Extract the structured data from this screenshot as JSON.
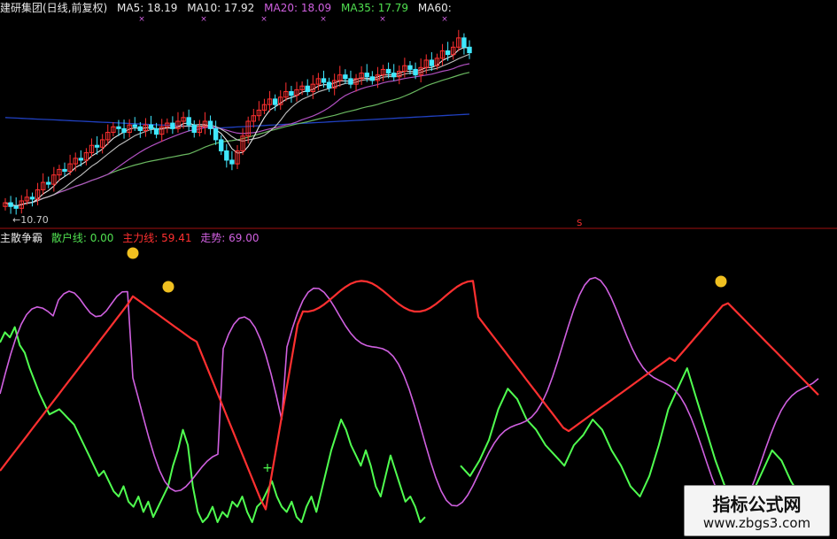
{
  "header": {
    "title": "建研集团(日线,前复权)",
    "ma": [
      {
        "label": "MA5: 18.19",
        "color": "#e8e8e8"
      },
      {
        "label": "MA10: 17.92",
        "color": "#e8e8e8"
      },
      {
        "label": "MA20: 18.09",
        "color": "#d060e0"
      },
      {
        "label": "MA35: 17.79",
        "color": "#50e050"
      },
      {
        "label": "MA60:",
        "color": "#e8e8e8"
      }
    ]
  },
  "lower_header": {
    "title": "主散争霸",
    "items": [
      {
        "label": "散户线: 0.00",
        "color": "#50e050"
      },
      {
        "label": "主力线: 59.41",
        "color": "#ff3030"
      },
      {
        "label": "走势: 69.00",
        "color": "#d060e0"
      }
    ]
  },
  "annotations": {
    "low_label": "←10.70",
    "s_mark": "S"
  },
  "watermark": {
    "line1": "指标公式网",
    "line2": "www.zbgs3.com"
  },
  "colors": {
    "up": "#ff3030",
    "down": "#40e8ff",
    "retail": "#50ff50",
    "main": "#ff3030",
    "trend": "#d060e0",
    "ma_white": "#e8e8e8",
    "ma_purple": "#b050c0",
    "ma_green": "#6ab860",
    "ma_blue": "#2040c0",
    "divider": "#a01010"
  },
  "chart_data": [
    {
      "type": "candlestick",
      "title": "建研集团(日线,前复权)",
      "x_index": [
        0,
        130
      ],
      "price_range": [
        10.2,
        21.0
      ],
      "low_marker": 10.7,
      "closes": [
        11.2,
        11.0,
        10.9,
        11.3,
        11.5,
        11.4,
        11.9,
        12.3,
        12.2,
        12.7,
        13.0,
        12.9,
        13.3,
        13.6,
        13.5,
        13.9,
        14.3,
        14.2,
        14.6,
        15.0,
        15.3,
        15.2,
        15.0,
        15.4,
        15.3,
        15.1,
        15.4,
        15.2,
        14.9,
        15.3,
        15.5,
        15.2,
        15.6,
        15.8,
        15.4,
        15.0,
        15.3,
        15.6,
        15.2,
        14.6,
        14.0,
        13.5,
        13.3,
        14.0,
        14.8,
        15.6,
        15.9,
        16.2,
        16.5,
        16.8,
        16.5,
        16.9,
        17.2,
        17.0,
        17.3,
        17.5,
        17.2,
        17.6,
        17.9,
        17.7,
        17.4,
        17.8,
        18.1,
        17.9,
        17.6,
        17.9,
        18.2,
        18.0,
        17.8,
        18.1,
        18.4,
        18.2,
        18.0,
        18.3,
        18.6,
        18.4,
        18.1,
        18.5,
        18.9,
        18.6,
        19.0,
        19.4,
        19.2,
        19.6,
        20.1,
        19.6,
        19.3
      ],
      "ma_lines": [
        {
          "name": "MA5",
          "color": "#e8e8e8",
          "last": 18.19
        },
        {
          "name": "MA10",
          "color": "#e8e8e8",
          "last": 17.92
        },
        {
          "name": "MA20",
          "color": "#d060e0",
          "last": 18.09
        },
        {
          "name": "MA35",
          "color": "#50e050",
          "last": 17.79
        },
        {
          "name": "MA60",
          "color": "#e8e8e8"
        }
      ]
    },
    {
      "type": "line",
      "title": "主散争霸",
      "ylim": [
        0,
        100
      ],
      "series": [
        {
          "name": "散户线",
          "color": "#50ff50",
          "last": 0.0,
          "values": [
            70,
            74,
            72,
            76,
            69,
            66,
            60,
            55,
            50,
            46,
            42,
            43,
            44,
            42,
            40,
            38,
            34,
            30,
            26,
            22,
            18,
            20,
            16,
            12,
            10,
            14,
            8,
            6,
            10,
            4,
            8,
            2,
            6,
            10,
            14,
            22,
            28,
            36,
            30,
            14,
            4,
            0,
            2,
            6,
            0,
            4,
            2,
            8,
            6,
            10,
            4,
            0,
            6,
            8,
            12,
            16,
            10,
            6,
            4,
            8,
            2,
            0,
            6,
            10,
            4,
            12,
            20,
            28,
            34,
            40,
            36,
            30,
            26,
            22,
            28,
            22,
            14,
            10,
            18,
            26,
            20,
            14,
            8,
            10,
            6,
            0,
            2
          ],
          "values_right": [
            22,
            18,
            24,
            32,
            44,
            52,
            48,
            40,
            36,
            30,
            26,
            22,
            30,
            34,
            40,
            36,
            28,
            22,
            14,
            10,
            18,
            30,
            44,
            52,
            60,
            48,
            36,
            24,
            14,
            8,
            6,
            12,
            20,
            28,
            24,
            16,
            10,
            4,
            0
          ]
        },
        {
          "name": "主力线",
          "color": "#ff3030",
          "last": 59.41
        },
        {
          "name": "走势",
          "color": "#d060e0",
          "last": 69.0
        }
      ]
    }
  ]
}
